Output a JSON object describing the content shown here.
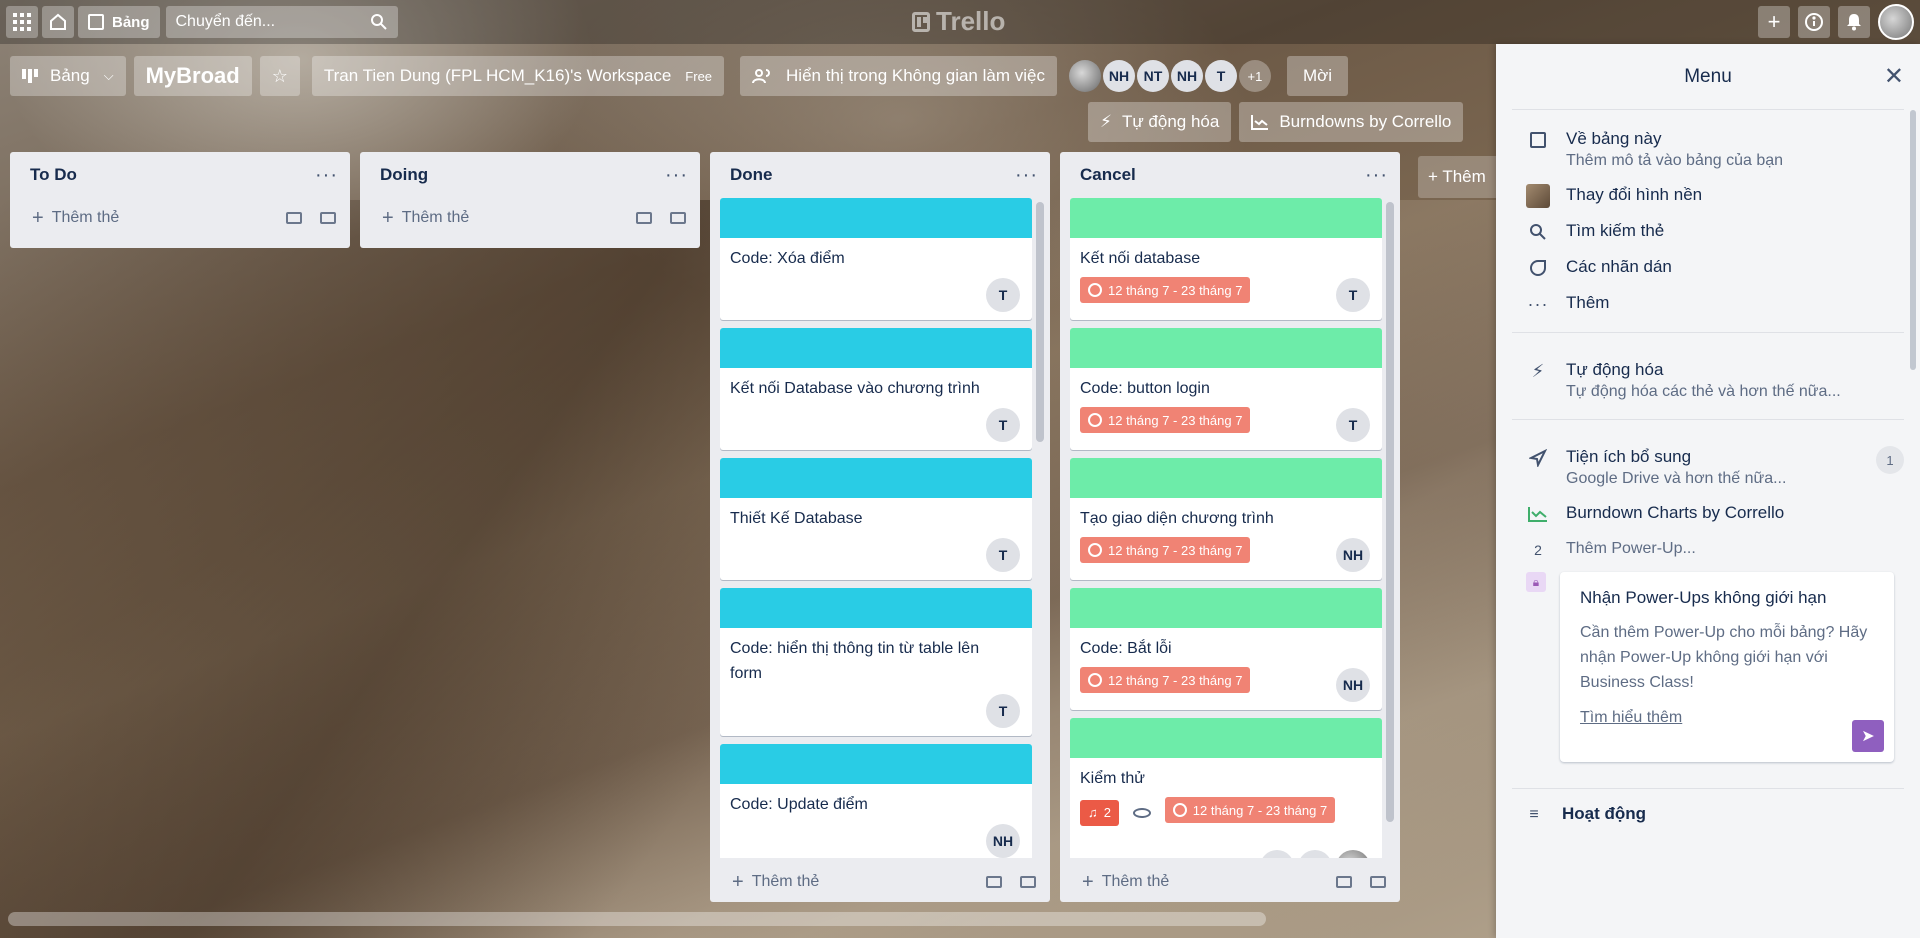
{
  "topbar": {
    "board_switch": "Bảng",
    "search_placeholder": "Chuyển đến...",
    "logo": "Trello"
  },
  "board": {
    "view": "Bảng",
    "title": "MyBroad",
    "workspace": "Tran Tien Dung (FPL HCM_K16)'s Workspace",
    "plan": "Free",
    "visibility": "Hiển thị trong Không gian làm việc",
    "members": [
      "NH",
      "NT",
      "NH",
      "T"
    ],
    "members_more": "+1",
    "invite": "Mời",
    "automation": "Tự động hóa",
    "burndown": "Burndowns by Corrello",
    "add_list": "+ Thêm"
  },
  "lists": [
    {
      "title": "To Do",
      "add_card": "Thêm thẻ",
      "cards": []
    },
    {
      "title": "Doing",
      "add_card": "Thêm thẻ",
      "cards": []
    },
    {
      "title": "Done",
      "add_card": "Thêm thẻ",
      "cards": [
        {
          "title": "Code: Xóa điểm",
          "members": [
            "T"
          ]
        },
        {
          "title": "Kết nối Database vào chương trình",
          "members": [
            "T"
          ]
        },
        {
          "title": "Thiết Kế Database",
          "members": [
            "T"
          ]
        },
        {
          "title": "Code: hiển thị thông tin từ table lên form",
          "members": [
            "T"
          ]
        },
        {
          "title": "Code: Update điểm",
          "members": [
            "NH"
          ]
        }
      ]
    },
    {
      "title": "Cancel",
      "add_card": "Thêm thẻ",
      "cards": [
        {
          "title": "Kết nối database",
          "date": "12 tháng 7 - 23 tháng 7",
          "members": [
            "T"
          ]
        },
        {
          "title": "Code: button login",
          "date": "12 tháng 7 - 23 tháng 7",
          "members": [
            "T"
          ]
        },
        {
          "title": "Tạo giao diện chương trình",
          "date": "12 tháng 7 - 23 tháng 7",
          "members": [
            "NH"
          ]
        },
        {
          "title": "Code: Bắt lỗi",
          "date": "12 tháng 7 - 23 tháng 7",
          "members": [
            "NH"
          ]
        },
        {
          "title": "Kiểm thử",
          "notif": "2",
          "date": "12 tháng 7 - 23 tháng 7",
          "members": [
            "NH",
            "NT"
          ]
        }
      ]
    }
  ],
  "menu": {
    "title": "Menu",
    "about": {
      "title": "Về bảng này",
      "sub": "Thêm mô tả vào bảng của bạn"
    },
    "background": "Thay đổi hình nền",
    "search": "Tìm kiếm thẻ",
    "stickers": "Các nhãn dán",
    "more": "Thêm",
    "automation": {
      "title": "Tự động hóa",
      "sub": "Tự động hóa các thẻ và hơn thế nữa..."
    },
    "powerups": {
      "title": "Tiện ích bổ sung",
      "sub": "Google Drive và hơn thế nữa...",
      "count": "1"
    },
    "burndown": "Burndown Charts by Corrello",
    "add_powerup_num": "2",
    "add_powerup": "Thêm Power-Up...",
    "promo": {
      "title": "Nhận Power-Ups không giới hạn",
      "body": "Cần thêm Power-Up cho mỗi bảng? Hãy nhận Power-Up không giới hạn với Business Class!",
      "link": "Tìm hiểu thêm"
    },
    "activity": "Hoạt động"
  },
  "colors": {
    "done_cover": "#29cce5",
    "cancel_cover": "#6deca9",
    "date_badge": "#eb5a46",
    "promo_accent": "#8f5fbf"
  }
}
